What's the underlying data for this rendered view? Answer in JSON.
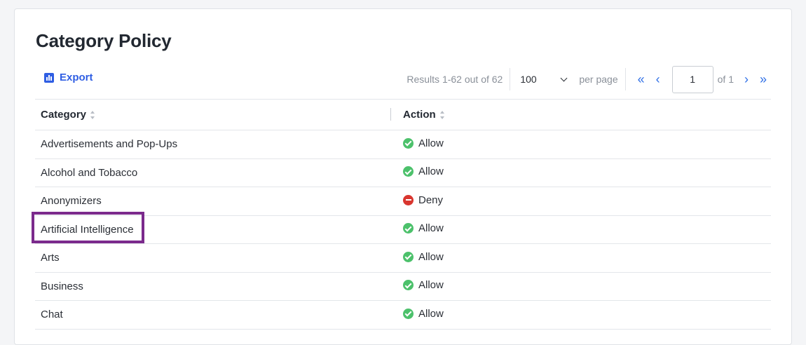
{
  "page": {
    "title": "Category Policy"
  },
  "toolbar": {
    "export_label": "Export",
    "export_icon": "bar-chart-icon",
    "results_text": "Results 1-62 out of 62",
    "per_page_value": "100",
    "per_page_label": "per page",
    "current_page": "1",
    "of_pages": "of 1",
    "first_icon": "double-chevron-left-icon",
    "prev_icon": "chevron-left-icon",
    "next_icon": "chevron-right-icon",
    "last_icon": "double-chevron-right-icon"
  },
  "table": {
    "columns": [
      "Category",
      "Action"
    ],
    "rows": [
      {
        "category": "Advertisements and Pop-Ups",
        "action": "Allow",
        "status": "allow"
      },
      {
        "category": "Alcohol and Tobacco",
        "action": "Allow",
        "status": "allow"
      },
      {
        "category": "Anonymizers",
        "action": "Deny",
        "status": "deny"
      },
      {
        "category": "Artificial Intelligence",
        "action": "Allow",
        "status": "allow"
      },
      {
        "category": "Arts",
        "action": "Allow",
        "status": "allow"
      },
      {
        "category": "Business",
        "action": "Allow",
        "status": "allow"
      },
      {
        "category": "Chat",
        "action": "Allow",
        "status": "allow"
      }
    ]
  },
  "colors": {
    "accent": "#2f5ee3",
    "allow": "#4cc16b",
    "deny": "#d9362f",
    "highlight": "#7b2a8c"
  }
}
